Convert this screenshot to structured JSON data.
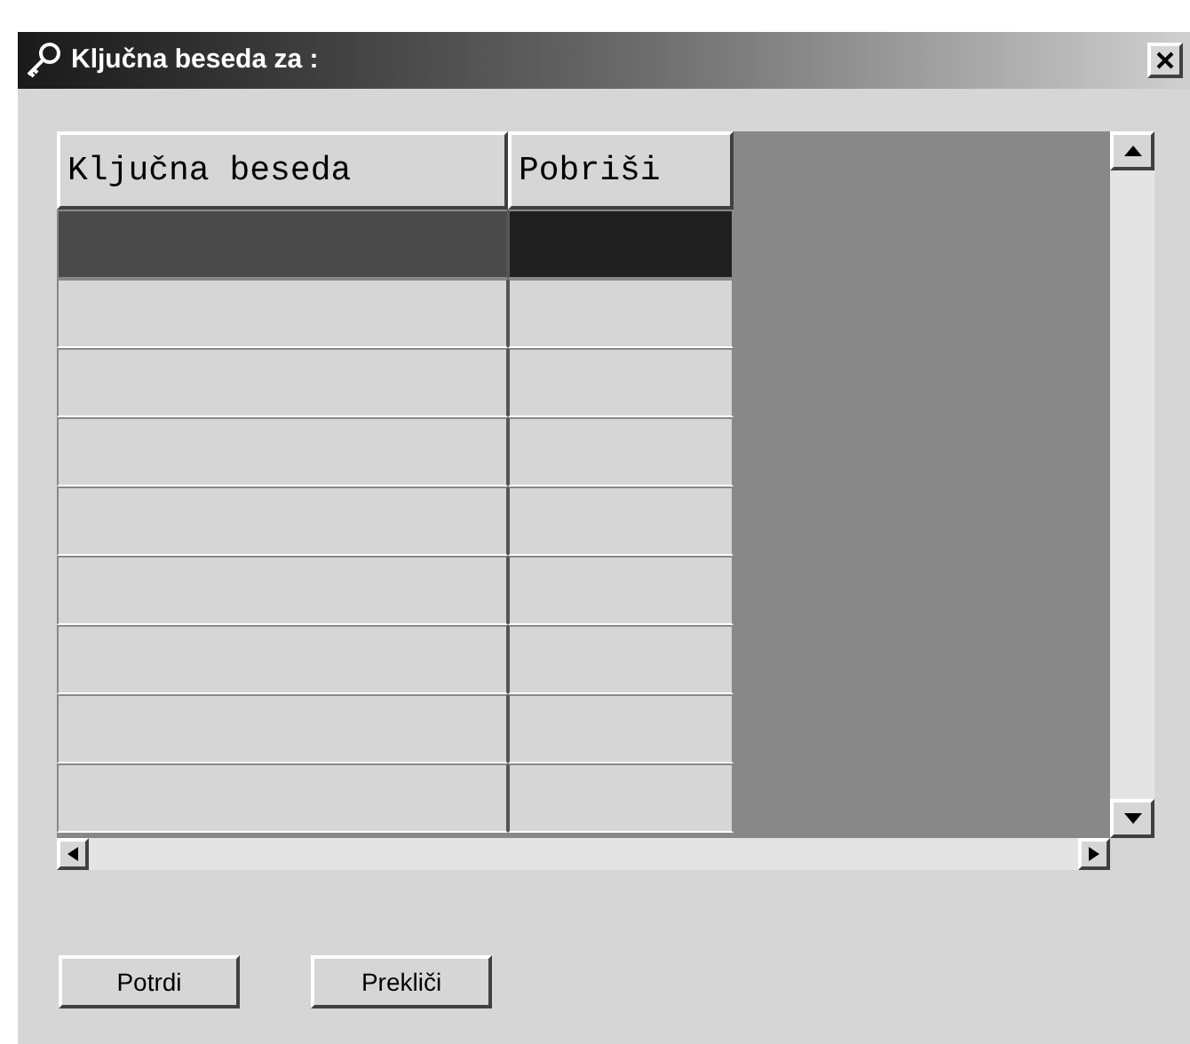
{
  "window": {
    "title": "Ključna beseda za :"
  },
  "table": {
    "columns": [
      "Ključna beseda",
      "Pobriši"
    ],
    "rows": [
      {
        "selected": true
      },
      {
        "selected": false
      },
      {
        "selected": false
      },
      {
        "selected": false
      },
      {
        "selected": false
      },
      {
        "selected": false
      },
      {
        "selected": false
      },
      {
        "selected": false
      },
      {
        "selected": false
      }
    ]
  },
  "buttons": [
    "Potrdi",
    "Prekliči"
  ]
}
